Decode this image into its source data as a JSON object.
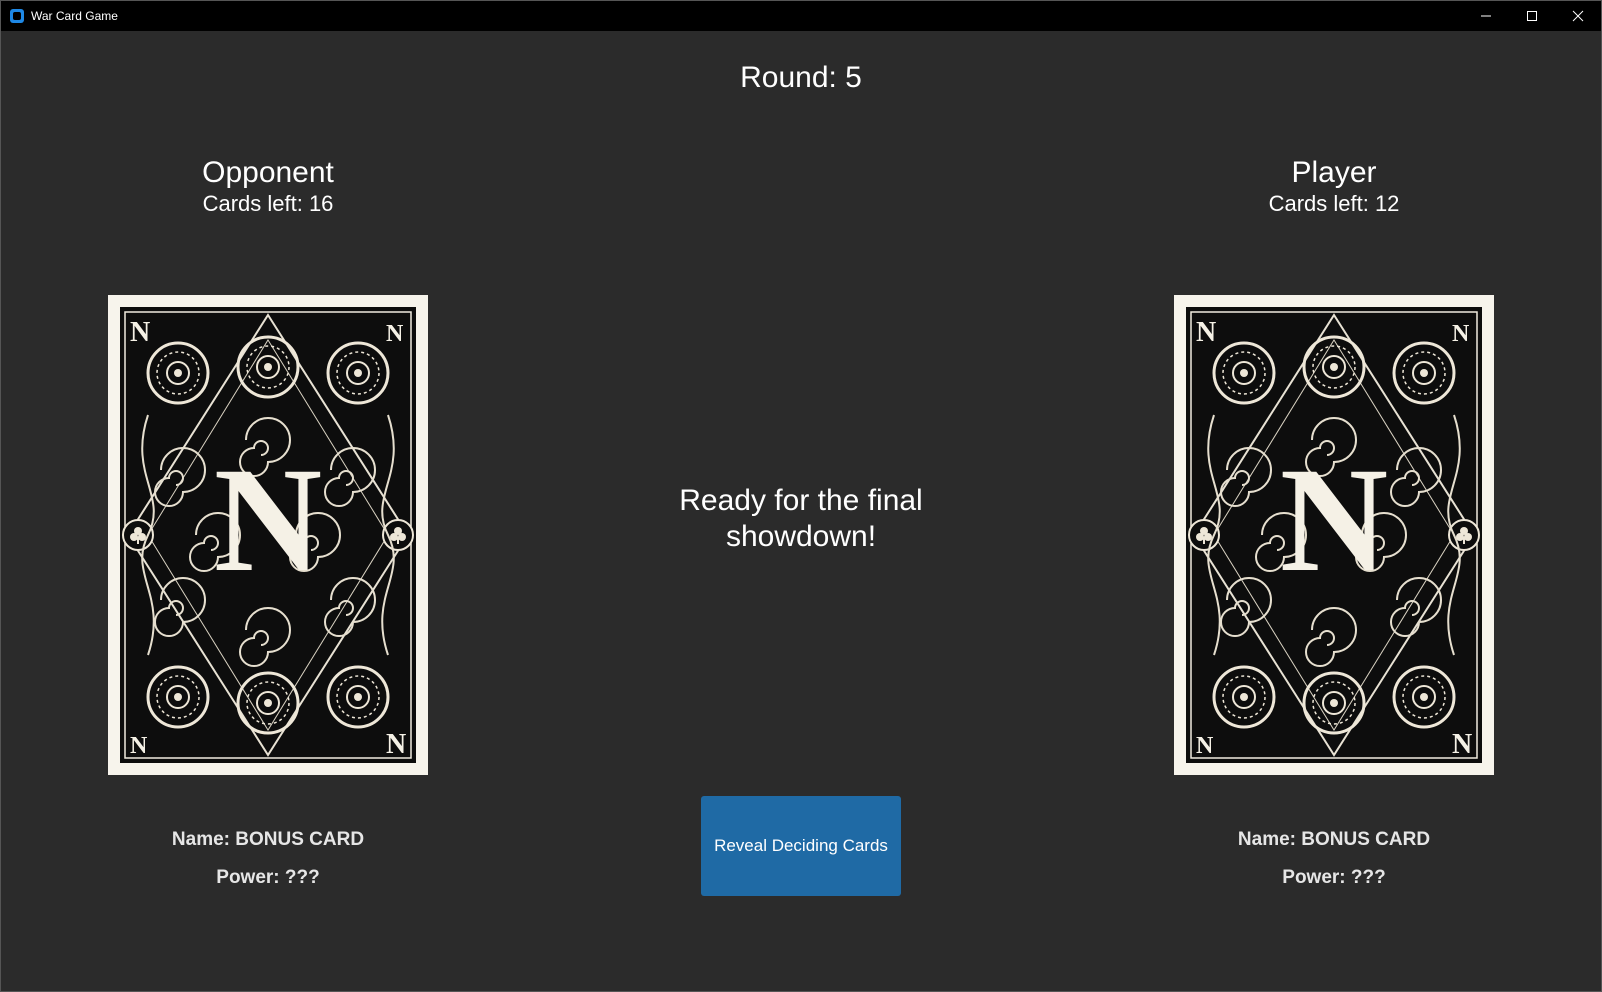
{
  "window": {
    "title": "War Card Game",
    "controls": [
      "minimize-icon",
      "maximize-icon",
      "close-icon"
    ]
  },
  "round_label": "Round: 5",
  "opponent": {
    "name": "Opponent",
    "cards_left": "Cards left: 16",
    "card_back_letter": "N",
    "card_name": "Name: BONUS CARD",
    "card_power": "Power: ???"
  },
  "player": {
    "name": "Player",
    "cards_left": "Cards left: 12",
    "card_back_letter": "N",
    "card_name": "Name: BONUS CARD",
    "card_power": "Power: ???"
  },
  "message": "Ready for the final showdown!",
  "reveal_button": "Reveal Deciding Cards",
  "colors": {
    "background": "#2b2b2b",
    "titlebar": "#000000",
    "button": "#1f6aa5",
    "text": "#ffffff"
  }
}
